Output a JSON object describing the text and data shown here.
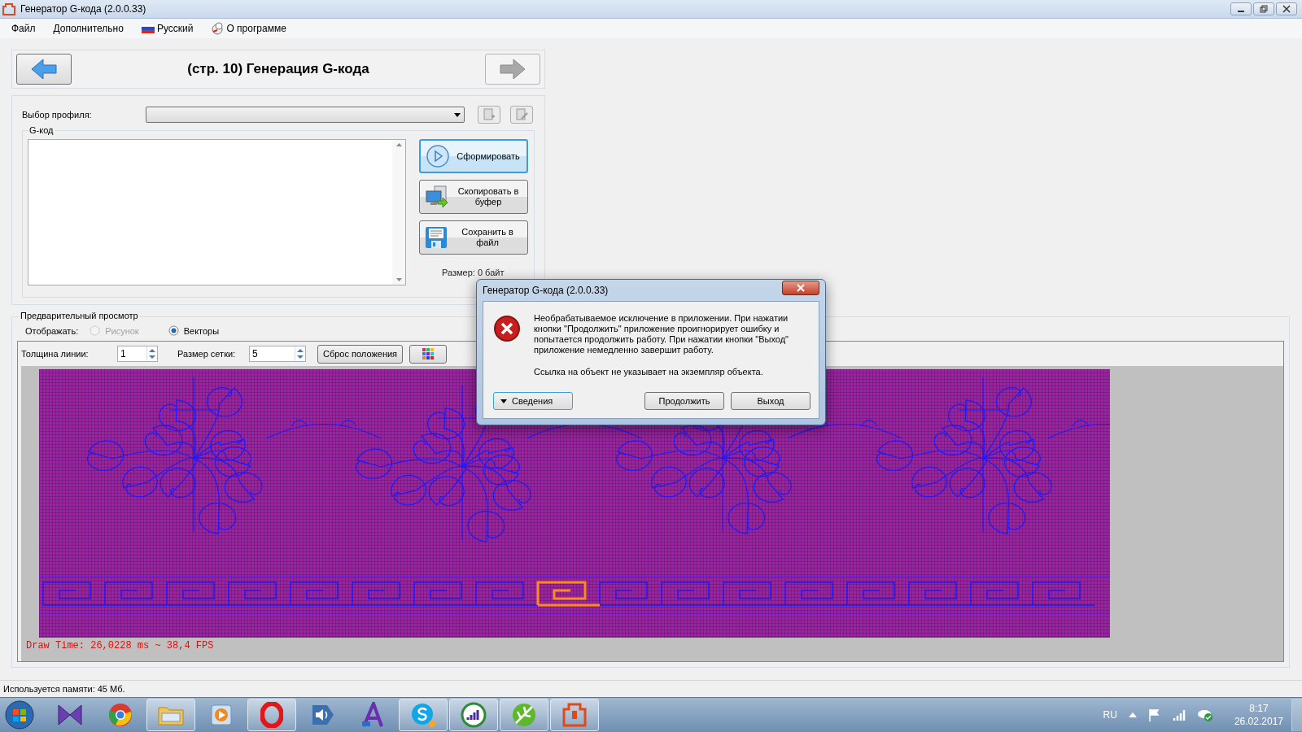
{
  "window": {
    "title": "Генератор G-кода (2.0.0.33)"
  },
  "menu": [
    {
      "label": "Файл",
      "kind": "text"
    },
    {
      "label": "Дополнительно",
      "kind": "text"
    },
    {
      "label": "Русский",
      "kind": "flag"
    },
    {
      "label": "О программе",
      "kind": "about"
    }
  ],
  "page": {
    "title": "(стр. 10) Генерация G-кода",
    "back": {
      "disabled": false
    },
    "forward": {
      "disabled": true
    }
  },
  "profile": {
    "label": "Выбор профиля:"
  },
  "gcode": {
    "label": "G-код",
    "actions": [
      {
        "label": "Сформировать",
        "kind": "play",
        "focused": true
      },
      {
        "label": "Скопировать в буфер",
        "kind": "copy",
        "focused": false
      },
      {
        "label": "Сохранить в файл",
        "kind": "save",
        "focused": false
      }
    ],
    "size": "Размер: 0 байт"
  },
  "preview": {
    "title": "Предварительный просмотр",
    "display_label": "Отображать:",
    "modes": [
      {
        "label": "Рисунок",
        "selected": false,
        "disabled": true
      },
      {
        "label": "Векторы",
        "selected": true,
        "disabled": false
      }
    ],
    "line_width": {
      "label": "Толщина линии:",
      "value": "1"
    },
    "grid_size": {
      "label": "Размер сетки:",
      "value": "5"
    },
    "reset_button": "Сброс положения",
    "draw_time": "Draw Time: 26,0228 ms ~ 38,4 FPS"
  },
  "status_bar": {
    "memory": "Используется памяти:  45  Мб."
  },
  "dialog": {
    "title": "Генератор G-кода (2.0.0.33)",
    "message": "Необрабатываемое исключение в приложении. При нажатии кнопки \"Продолжить\" приложение проигнорирует ошибку и попытается продолжить работу. При нажатии кнопки \"Выход\" приложение немедленно завершит работу.",
    "detail": "Ссылка на объект не указывает на экземпляр объекта.",
    "details_button": "Сведения",
    "buttons": [
      "Продолжить",
      "Выход"
    ]
  },
  "taskbar": {
    "apps": [
      {
        "kind": "bowtie",
        "running": false
      },
      {
        "kind": "browser",
        "running": false
      },
      {
        "kind": "folder",
        "running": true
      },
      {
        "kind": "media",
        "running": false
      },
      {
        "kind": "ring",
        "running": true
      },
      {
        "kind": "speaker",
        "running": false
      },
      {
        "kind": "font",
        "running": false
      },
      {
        "kind": "chat",
        "running": true
      },
      {
        "kind": "bars",
        "running": true
      },
      {
        "kind": "pen",
        "running": true
      },
      {
        "kind": "machine",
        "running": true
      }
    ],
    "tray": {
      "language": "RU",
      "time": "8:17",
      "date": "26.02.2017"
    }
  }
}
